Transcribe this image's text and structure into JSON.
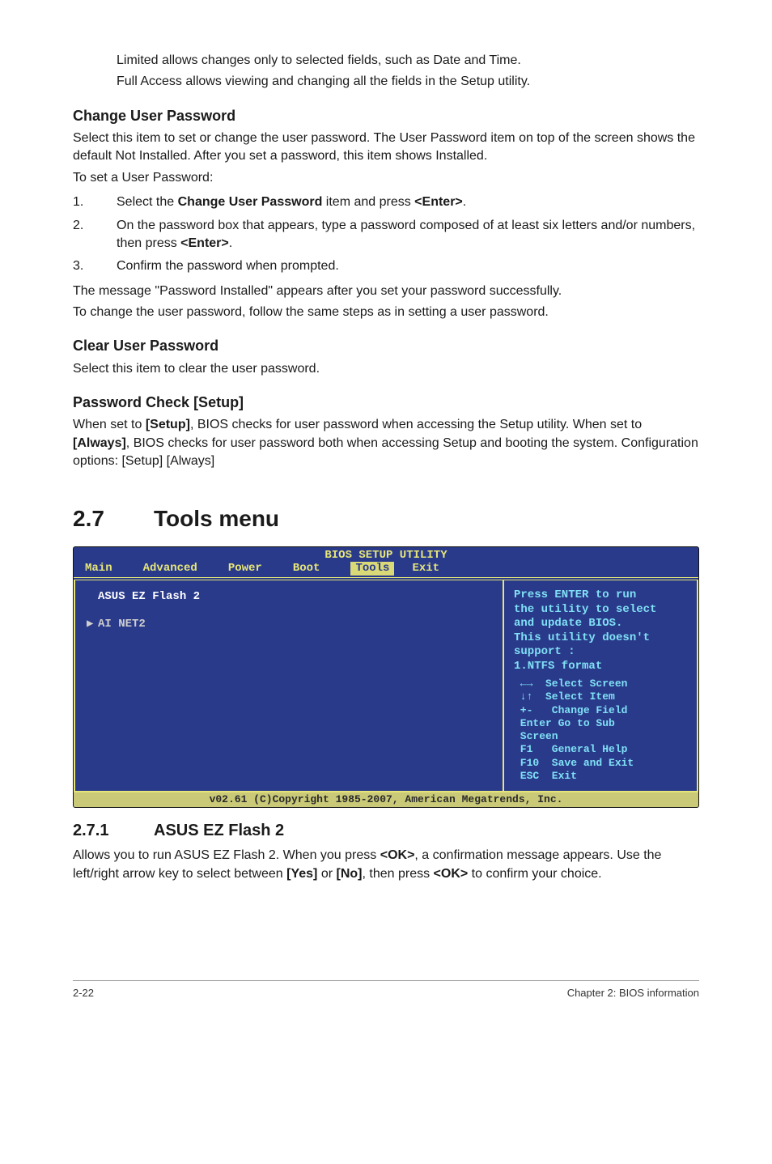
{
  "top": {
    "line1": "Limited allows changes only to selected fields, such as Date and Time.",
    "line2": "Full Access allows viewing and changing all the fields in the Setup utility."
  },
  "sec1": {
    "title": "Change User Password",
    "p1": "Select this item to set or change the user password. The User Password item on top of the screen shows the default Not Installed. After you set a password, this item shows Installed.",
    "p2": "To set a User Password:",
    "ol": [
      {
        "n": "1.",
        "pre": "Select the ",
        "b1": "Change User Password",
        "mid": " item and press ",
        "b2": "<Enter>",
        "post": "."
      },
      {
        "n": "2.",
        "pre": "On the password box that appears, type a password composed of at least six letters and/or numbers, then press ",
        "b1": "<Enter>",
        "mid": "",
        "b2": "",
        "post": "."
      },
      {
        "n": "3.",
        "pre": "Confirm the password when prompted.",
        "b1": "",
        "mid": "",
        "b2": "",
        "post": ""
      }
    ],
    "p3": "The message \"Password Installed\" appears after you set your password successfully.",
    "p4": "To change the user password, follow the same steps as in setting a user password."
  },
  "sec2": {
    "title": "Clear User Password",
    "p1": "Select this item to clear the user password."
  },
  "sec3": {
    "title": "Password Check [Setup]",
    "p1a": "When set to ",
    "p1b": "[Setup]",
    "p1c": ", BIOS checks for user password when accessing the Setup utility. When set to ",
    "p1d": "[Always]",
    "p1e": ", BIOS checks for user password both when accessing Setup and booting the system. Configuration options: [Setup] [Always]"
  },
  "h2": {
    "num": "2.7",
    "title": "Tools menu"
  },
  "bios": {
    "title": "BIOS SETUP UTILITY",
    "tabs": [
      "Main",
      "Advanced",
      "Power",
      "Boot",
      "Tools",
      "Exit"
    ],
    "activeTab": "Tools",
    "items": [
      {
        "ptr": "",
        "label": "ASUS EZ Flash 2"
      },
      {
        "ptr": "▶",
        "label": "AI NET2"
      }
    ],
    "helpTop": "Press ENTER to run\nthe utility to select\nand update BIOS.\nThis utility doesn't\nsupport :\n1.NTFS format",
    "helpBot": " ←→  Select Screen\n ↓↑  Select Item\n +-   Change Field\n Enter Go to Sub\n Screen\n F1   General Help\n F10  Save and Exit\n ESC  Exit",
    "footer": "v02.61 (C)Copyright 1985-2007, American Megatrends, Inc."
  },
  "h3sub": {
    "num": "2.7.1",
    "title": "ASUS EZ Flash 2"
  },
  "final": {
    "a": "Allows you to run ASUS EZ Flash 2. When you press ",
    "b": "<OK>",
    "c": ", a confirmation message appears. Use the left/right arrow key to select between ",
    "d": "[Yes]",
    "e": " or ",
    "f": "[No]",
    "g": ", then press ",
    "h": "<OK>",
    "i": " to confirm your choice."
  },
  "footer": {
    "left": "2-22",
    "right": "Chapter 2: BIOS information"
  }
}
